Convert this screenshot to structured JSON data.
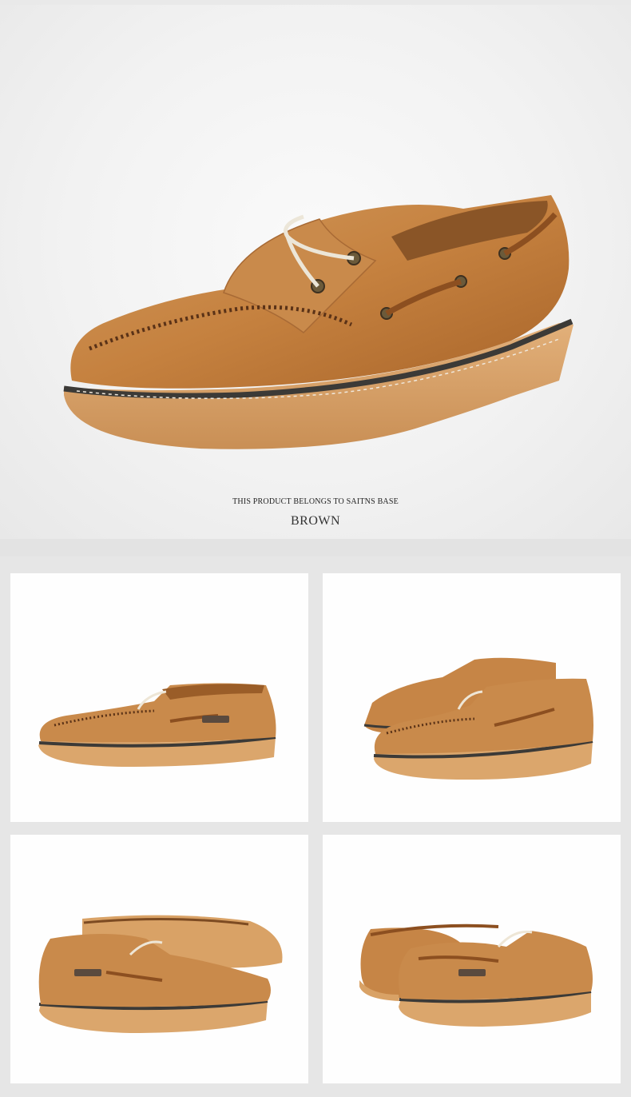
{
  "hero": {
    "product_image": "brown-leather-boat-shoe",
    "tagline": "THIS PRODUCT BELONGS TO SAITNS BASE",
    "color_name": "BROWN"
  },
  "gallery": {
    "tiles": [
      {
        "image": "boat-shoe-side-view"
      },
      {
        "image": "boat-shoe-pair-angle-view"
      },
      {
        "image": "boat-shoe-pair-with-sole-view"
      },
      {
        "image": "boat-shoe-pair-back-view"
      }
    ]
  },
  "colors": {
    "leather": "#c98a4b",
    "leather_dark": "#9a5d28",
    "sole": "#d8a46a",
    "welt": "#3c3a37"
  }
}
